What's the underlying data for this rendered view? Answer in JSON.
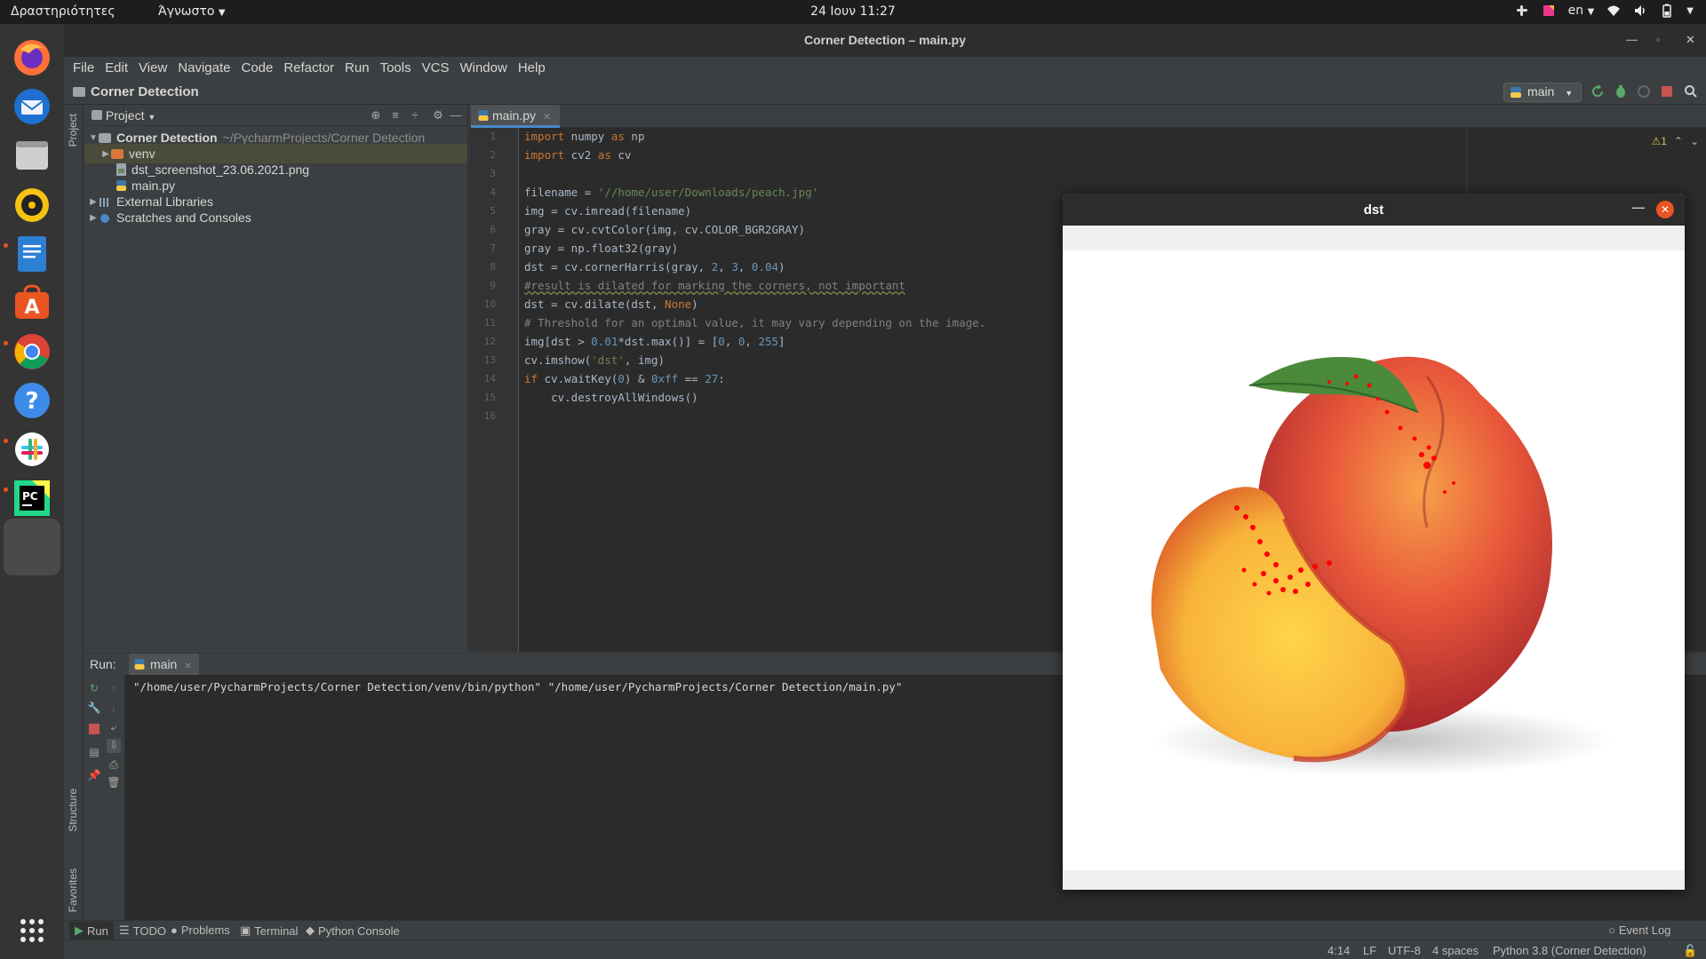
{
  "topbar": {
    "activities": "Δραστηριότητες",
    "app_menu": "Άγνωστο",
    "clock": "24 Ιουν  11:27",
    "lang": "en"
  },
  "dock": {
    "items": [
      "firefox-icon",
      "thunderbird-icon",
      "files-icon",
      "rhythmbox-icon",
      "writer-icon",
      "software-icon",
      "chrome-icon",
      "help-icon",
      "slack-icon",
      "pycharm-icon",
      "blank-window-icon"
    ],
    "show_apps": "show-applications-icon"
  },
  "window": {
    "title": "Corner Detection – main.py"
  },
  "menu": [
    "File",
    "Edit",
    "View",
    "Navigate",
    "Code",
    "Refactor",
    "Run",
    "Tools",
    "VCS",
    "Window",
    "Help"
  ],
  "nav": {
    "breadcrumb": "Corner Detection",
    "run_config": "main"
  },
  "project": {
    "title": "Project",
    "root_name": "Corner Detection",
    "root_path": "~/PycharmProjects/Corner Detection",
    "venv": "venv",
    "png": "dst_screenshot_23.06.2021.png",
    "main": "main.py",
    "external": "External Libraries",
    "scratches": "Scratches and Consoles"
  },
  "side_tabs": {
    "project": "Project",
    "structure": "Structure",
    "favorites": "Favorites"
  },
  "editor": {
    "tab": "main.py",
    "inspection": "⚠1",
    "lines": [
      "1",
      "2",
      "3",
      "4",
      "5",
      "6",
      "7",
      "8",
      "9",
      "10",
      "11",
      "12",
      "13",
      "14",
      "15",
      "16"
    ]
  },
  "code": {
    "l1": [
      "import",
      " numpy ",
      "as",
      " np"
    ],
    "l2": [
      "import",
      " cv2 ",
      "as",
      " cv"
    ],
    "l4": [
      "filename = ",
      "'//home/user/Downloads/peach.jpg'"
    ],
    "l5": "img = cv.imread(filename)",
    "l6": "gray = cv.cvtColor(img, cv.COLOR_BGR2GRAY)",
    "l7": "gray = np.float32(gray)",
    "l8": [
      "dst = cv.cornerHarris(gray, ",
      "2",
      ", ",
      "3",
      ", ",
      "0.04",
      ")"
    ],
    "l9": "#result is dilated for marking the corners, not important",
    "l10": [
      "dst = cv.dilate(dst, ",
      "None",
      ")"
    ],
    "l11": "# Threshold for an optimal value, it may vary depending on the image.",
    "l12": [
      "img[dst > ",
      "0.01",
      "*dst.max()] = [",
      "0",
      ", ",
      "0",
      ", ",
      "255",
      "]"
    ],
    "l13": [
      "cv.imshow(",
      "'dst'",
      ", img)"
    ],
    "l14": [
      "if",
      " cv.waitKey(",
      "0",
      ") & ",
      "0xff",
      " == ",
      "27",
      ":"
    ],
    "l15": "    cv.destroyAllWindows()"
  },
  "run": {
    "label": "Run:",
    "tab": "main",
    "console": "\"/home/user/PycharmProjects/Corner Detection/venv/bin/python\" \"/home/user/PycharmProjects/Corner Detection/main.py\""
  },
  "bottom_tools": {
    "run": "Run",
    "todo": "TODO",
    "problems": "Problems",
    "terminal": "Terminal",
    "python_console": "Python Console",
    "event_log": "Event Log"
  },
  "status": {
    "pos": "4:14",
    "le": "LF",
    "enc": "UTF-8",
    "indent": "4 spaces",
    "interp": "Python 3.8 (Corner Detection)"
  },
  "dst_window": {
    "title": "dst"
  },
  "colors": {
    "accent_orange": "#e95420",
    "keyword": "#cc7832",
    "string": "#6a8759",
    "number": "#6897bb",
    "comment": "#808080",
    "corner_marks": "#ff0000"
  }
}
